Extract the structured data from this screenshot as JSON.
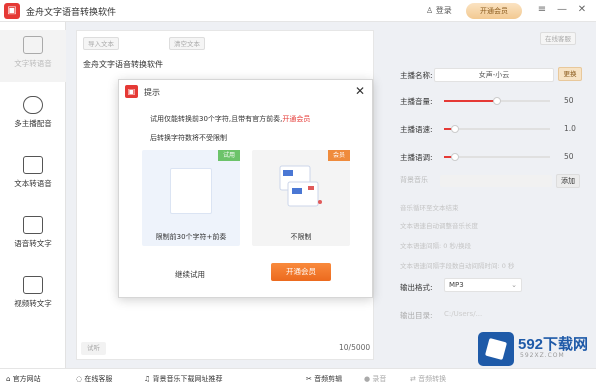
{
  "app": {
    "title": "金舟文字语音转换软件",
    "logo_glyph": "▣",
    "login": "登录",
    "open_vip": "开通会员"
  },
  "window_controls": {
    "menu": "≡",
    "minimize": "—",
    "close": "✕"
  },
  "sidebar": {
    "items": [
      {
        "label": "文字转语音",
        "icon": "text-to-speech-icon",
        "active": true
      },
      {
        "label": "多主播配音",
        "icon": "multi-anchor-icon"
      },
      {
        "label": "文本转语音",
        "icon": "text-file-icon"
      },
      {
        "label": "语音转文字",
        "icon": "speech-to-text-icon"
      },
      {
        "label": "视频转文字",
        "icon": "video-to-text-icon"
      }
    ]
  },
  "main": {
    "btn_import": "导入文本",
    "btn_clear": "清空文本",
    "heading": "金舟文字语音转换软件",
    "char_count": "10/5000",
    "btn_bottom": "试听"
  },
  "right": {
    "btn_top": "在线客服",
    "voice_label": "主播名称:",
    "voice_value": "女声-小云",
    "voice_btn": "更换",
    "volume_label": "主播音量:",
    "volume_value": "50",
    "volume_fraction": 0.5,
    "speed_label": "主播语速:",
    "speed_value": "1.0",
    "speed_fraction": 0.1,
    "pitch_label": "主播语调:",
    "pitch_value": "50",
    "pitch_fraction": 0.1,
    "bg_music_label": "背景音乐",
    "add_btn": "添加",
    "faded_1": "音乐循环至文本结束",
    "faded_2": "文本语速自动调整音乐长度",
    "faded_3": "文本语速间隔: 0 秒/换段",
    "faded_4": "文本语速间隔字段数自动间隔时间: 0 秒",
    "format_label": "输出格式:",
    "format_value": "MP3",
    "output_label": "输出目录:",
    "output_value": "C:/Users/..."
  },
  "bottombar": {
    "items": [
      {
        "label": "官方网站",
        "icon": "home-icon"
      },
      {
        "label": "在线客服",
        "icon": "chat-icon"
      },
      {
        "label": "背景音乐下载网址推荐",
        "icon": "music-icon"
      },
      {
        "label": "音频剪辑",
        "icon": "scissors-icon"
      },
      {
        "label": "录音",
        "icon": "mic-icon"
      },
      {
        "label": "音频转换",
        "icon": "convert-icon"
      }
    ]
  },
  "dialog": {
    "title": "提示",
    "close": "✕",
    "msg_line1_a": "试用仅能转换前30个字符,且带有官方前奏,",
    "msg_line1_b": "开通会员",
    "msg_line2": "后转换字符数将不受限制",
    "card_left_badge": "试用",
    "card_left_caption": "限制前30个字符+前奏",
    "card_right_badge": "会员",
    "card_right_caption": "不限制",
    "btn_continue": "继续试用",
    "btn_vip": "开通会员"
  },
  "watermark": {
    "brand": "592下载网",
    "sub": "592XZ.COM"
  },
  "colors": {
    "accent_red": "#e53935",
    "vip_orange": "#ec6a1e",
    "brand_blue": "#1e5aa8"
  }
}
